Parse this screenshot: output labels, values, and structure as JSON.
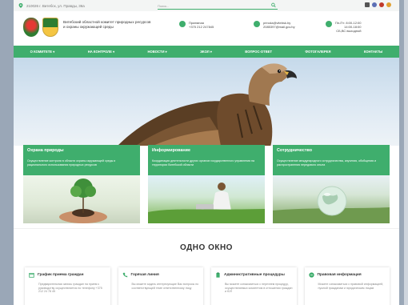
{
  "topbar": {
    "address": "210026 г. Витебск, ул. Правды, 36а",
    "search_placeholder": "Поиск..."
  },
  "header": {
    "org_name": "Витебский областной комитет природных ресурсов и охраны окружающей среды",
    "reception_label": "Приемная",
    "reception_phone": "+375 212 247845",
    "email_1": "priroda@vitebsk.by",
    "email_2": "2085397@mail.gov.by",
    "hours_1": "Пн-Пт: 8:00-12:00",
    "hours_2": "14:00-18:00",
    "hours_3": "СБ,ВС выходной"
  },
  "nav": {
    "items": [
      "О КОМИТЕТЕ ▾",
      "НА КОНТРОЛЕ ▾",
      "НОВОСТИ ▾",
      "ЭКОЛ ▾",
      "ВОПРОС-ОТВЕТ",
      "ФОТОГАЛЕРЕЯ",
      "КОНТАКТЫ"
    ]
  },
  "cards": [
    {
      "title": "Охрана природы",
      "desc": "Осуществление контроля в области охраны окружающей среды и рационального использования природных ресурсов"
    },
    {
      "title": "Информирование",
      "desc": "Координация деятельности других органов государственного управления на территории Витебской области"
    },
    {
      "title": "Сотрудничество",
      "desc": "Осуществление международного сотрудничества, изучения, обобщения и распространения передового опыта"
    }
  ],
  "single_window": {
    "title": "ОДНО ОКНО",
    "items": [
      {
        "title": "График приема граждан",
        "text": "Предварительная запись граждан на прием к руководству осуществляется по телефону +375 212 24 78 45"
      },
      {
        "title": "Горячая линия",
        "text": "Вы можете задать интересующие Вас вопросы по соответствующей теме ответственному лицу"
      },
      {
        "title": "Административные процедуры",
        "text": "Вы можете ознакомиться с перечнем процедур, осуществляемых комитетом в отношении граждан и ЮЛ"
      },
      {
        "title": "Правовая информация",
        "text": "Можете ознакомиться с правовой информацией, нужной гражданам и юридическим лицам"
      }
    ]
  },
  "colors": {
    "accent": "#3fae6d"
  }
}
